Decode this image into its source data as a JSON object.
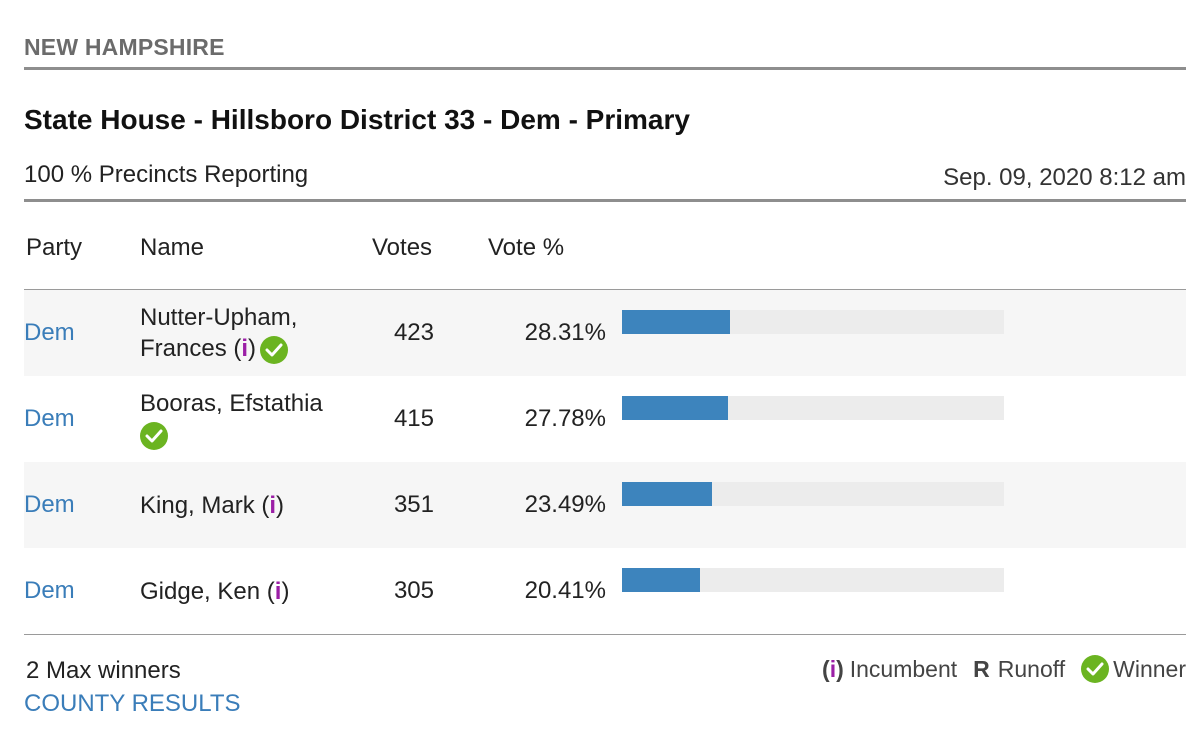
{
  "header": {
    "state": "NEW HAMPSHIRE",
    "race_title": "State House - Hillsboro District 33 - Dem - Primary",
    "reporting": "100 % Precincts Reporting",
    "timestamp": "Sep. 09, 2020 8:12 am"
  },
  "columns": {
    "party": "Party",
    "name": "Name",
    "votes": "Votes",
    "vote_pct": "Vote %"
  },
  "candidates": [
    {
      "party": "Dem",
      "name_line1": "Nutter-Upham,",
      "name_line2": "Frances",
      "incumbent": true,
      "winner": true,
      "votes": "423",
      "pct": "28.31%",
      "pct_value": 28.31
    },
    {
      "party": "Dem",
      "name_line1": "Booras, Efstathia",
      "name_line2": "",
      "incumbent": false,
      "winner": true,
      "votes": "415",
      "pct": "27.78%",
      "pct_value": 27.78
    },
    {
      "party": "Dem",
      "name_line1": "King, Mark",
      "name_line2": "",
      "incumbent": true,
      "winner": false,
      "votes": "351",
      "pct": "23.49%",
      "pct_value": 23.49
    },
    {
      "party": "Dem",
      "name_line1": "Gidge, Ken",
      "name_line2": "",
      "incumbent": true,
      "winner": false,
      "votes": "305",
      "pct": "20.41%",
      "pct_value": 20.41
    }
  ],
  "footer": {
    "max_winners": "2 Max winners",
    "county_results": "COUNTY RESULTS",
    "legend_incumbent_symbol": "i",
    "legend_incumbent": "Incumbent",
    "legend_runoff_symbol": "R",
    "legend_runoff": "Runoff",
    "legend_winner": "Winner"
  },
  "colors": {
    "party_link": "#3a7db9",
    "bar": "#3d84bd",
    "bar_track": "#ececec",
    "incumbent": "#9b1fa6",
    "winner_check": "#6bb421"
  }
}
